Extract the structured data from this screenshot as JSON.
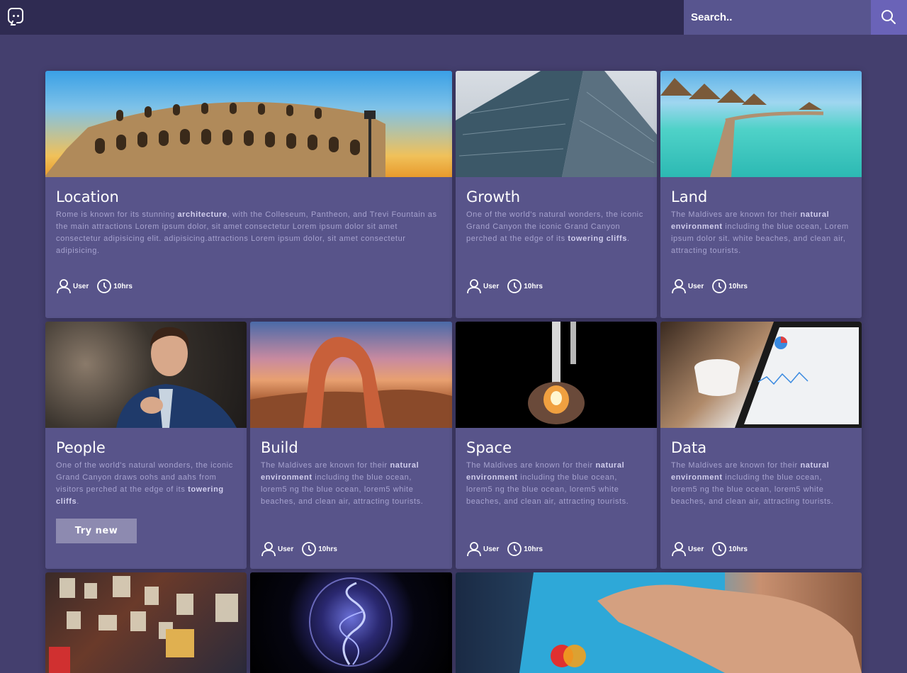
{
  "header": {
    "search": {
      "placeholder": "Search.."
    },
    "colors": {
      "bar": "#2f2b52",
      "search_bg": "#58558f",
      "search_btn": "#6a63b8"
    }
  },
  "cards": [
    {
      "title": "Location",
      "desc_parts": [
        "Rome is known for its stunning ",
        "architecture",
        ", with the Colleseum, Pantheon, and Trevi Fountain as the main attractions Lorem ipsum dolor, sit amet consectetur Lorem ipsum dolor sit amet consectetur adipisicing elit. adipisicing.attractions Lorem ipsum dolor, sit amet consectetur adipisicing."
      ],
      "user": "User",
      "time": "10hrs",
      "image": "colosseum-photo"
    },
    {
      "title": "Growth",
      "desc_parts": [
        "One of the world's natural wonders, the iconic Grand Canyon the iconic Grand Canyon perched at the edge of its ",
        "towering cliffs",
        "."
      ],
      "user": "User",
      "time": "10hrs",
      "image": "skyscraper-photo"
    },
    {
      "title": "Land",
      "desc_parts": [
        "The Maldives are known for their ",
        "natural environment",
        " including the blue ocean, Lorem ipsum dolor sit. white beaches, and clean air, attracting tourists."
      ],
      "user": "User",
      "time": "10hrs",
      "image": "maldives-photo"
    },
    {
      "title": "People",
      "desc_parts": [
        "One of the world's natural wonders, the iconic Grand Canyon draws oohs and aahs from visitors perched at the edge of its ",
        "towering cliffs",
        "."
      ],
      "button": "Try new",
      "image": "man-in-suit-photo"
    },
    {
      "title": "Build",
      "desc_parts": [
        "The Maldives are known for their ",
        "natural environment",
        " including the blue ocean, lorem5 ng the blue ocean, lorem5 white beaches, and clean air, attracting tourists."
      ],
      "user": "User",
      "time": "10hrs",
      "image": "rock-arch-photo"
    },
    {
      "title": "Space",
      "desc_parts": [
        "The Maldives are known for their ",
        "natural environment",
        " including the blue ocean, lorem5 ng the blue ocean, lorem5 white beaches, and clean air, attracting tourists."
      ],
      "user": "User",
      "time": "10hrs",
      "image": "rocket-launch-photo"
    },
    {
      "title": "Data",
      "desc_parts": [
        "The Maldives are known for their ",
        "natural environment",
        " including the blue ocean, lorem5 ng the blue ocean, lorem5 white beaches, and clean air, attracting tourists."
      ],
      "user": "User",
      "time": "10hrs",
      "image": "tablet-dashboard-photo"
    },
    {
      "image": "poster-wall-photo"
    },
    {
      "image": "plasma-bulb-photo"
    },
    {
      "image": "credit-card-photo"
    }
  ]
}
